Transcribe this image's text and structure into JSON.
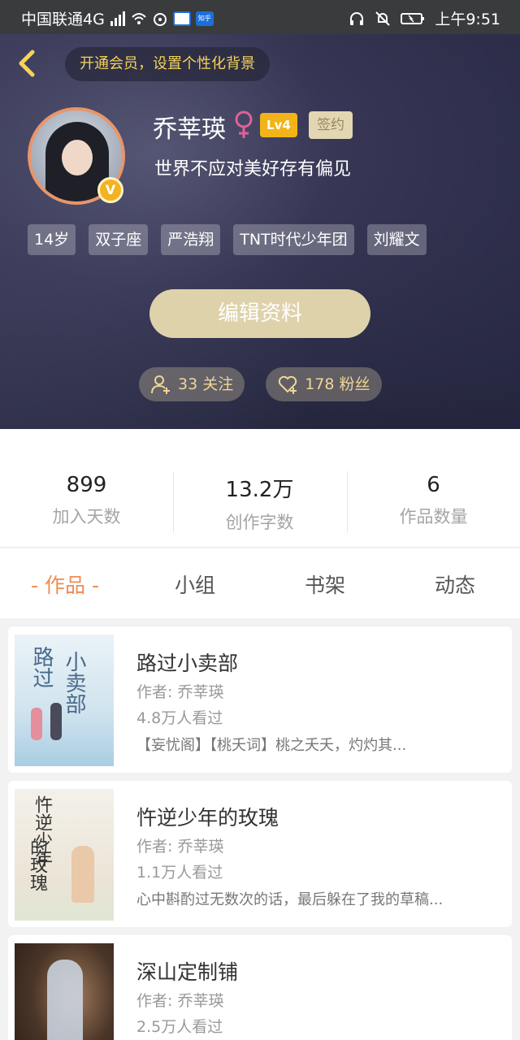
{
  "status_bar": {
    "carrier": "中国联通4G",
    "net_superscript": "4G",
    "app_badge_1": "",
    "app_badge_2": "知乎",
    "time": "上午9:51"
  },
  "header": {
    "vip_prompt": "开通会员，设置个性化背景",
    "user_name": "乔莘瑛",
    "level_badge": "Lv4",
    "sign_badge": "签约",
    "v_badge": "V",
    "bio": "世界不应对美好存有偏见",
    "tags": [
      "14岁",
      "双子座",
      "严浩翔",
      "TNT时代少年团",
      "刘耀文"
    ],
    "edit_button": "编辑资料",
    "follow_label": "33 关注",
    "fans_label": "178 粉丝"
  },
  "stats": [
    {
      "value": "899",
      "label": "加入天数"
    },
    {
      "value": "13.2万",
      "label": "创作字数"
    },
    {
      "value": "6",
      "label": "作品数量"
    }
  ],
  "tabs": [
    {
      "label": "- 作品 -",
      "active": true
    },
    {
      "label": "小组",
      "active": false
    },
    {
      "label": "书架",
      "active": false
    },
    {
      "label": "动态",
      "active": false
    }
  ],
  "works": [
    {
      "title": "路过小卖部",
      "author": "作者: 乔莘瑛",
      "views": "4.8万人看过",
      "desc": "【妄忧阁】【桃夭词】桃之夭夭，灼灼其...",
      "cover_text_1": "路过",
      "cover_text_2": "小卖部"
    },
    {
      "title": "忤逆少年的玫瑰",
      "author": "作者: 乔莘瑛",
      "views": "1.1万人看过",
      "desc": "心中斟酌过无数次的话，最后躲在了我的草稿...",
      "cover_text_1": "忤逆少年",
      "cover_text_2": "的玫瑰"
    },
    {
      "title": "深山定制铺",
      "author": "作者: 乔莘瑛",
      "views": "2.5万人看过",
      "desc": "",
      "cover_text_1": "",
      "cover_text_2": ""
    }
  ],
  "colors": {
    "accent_orange": "#ee8c54",
    "gold": "#f3d35a",
    "lv_badge": "#f2b418",
    "edit_button": "#ded2ab"
  }
}
